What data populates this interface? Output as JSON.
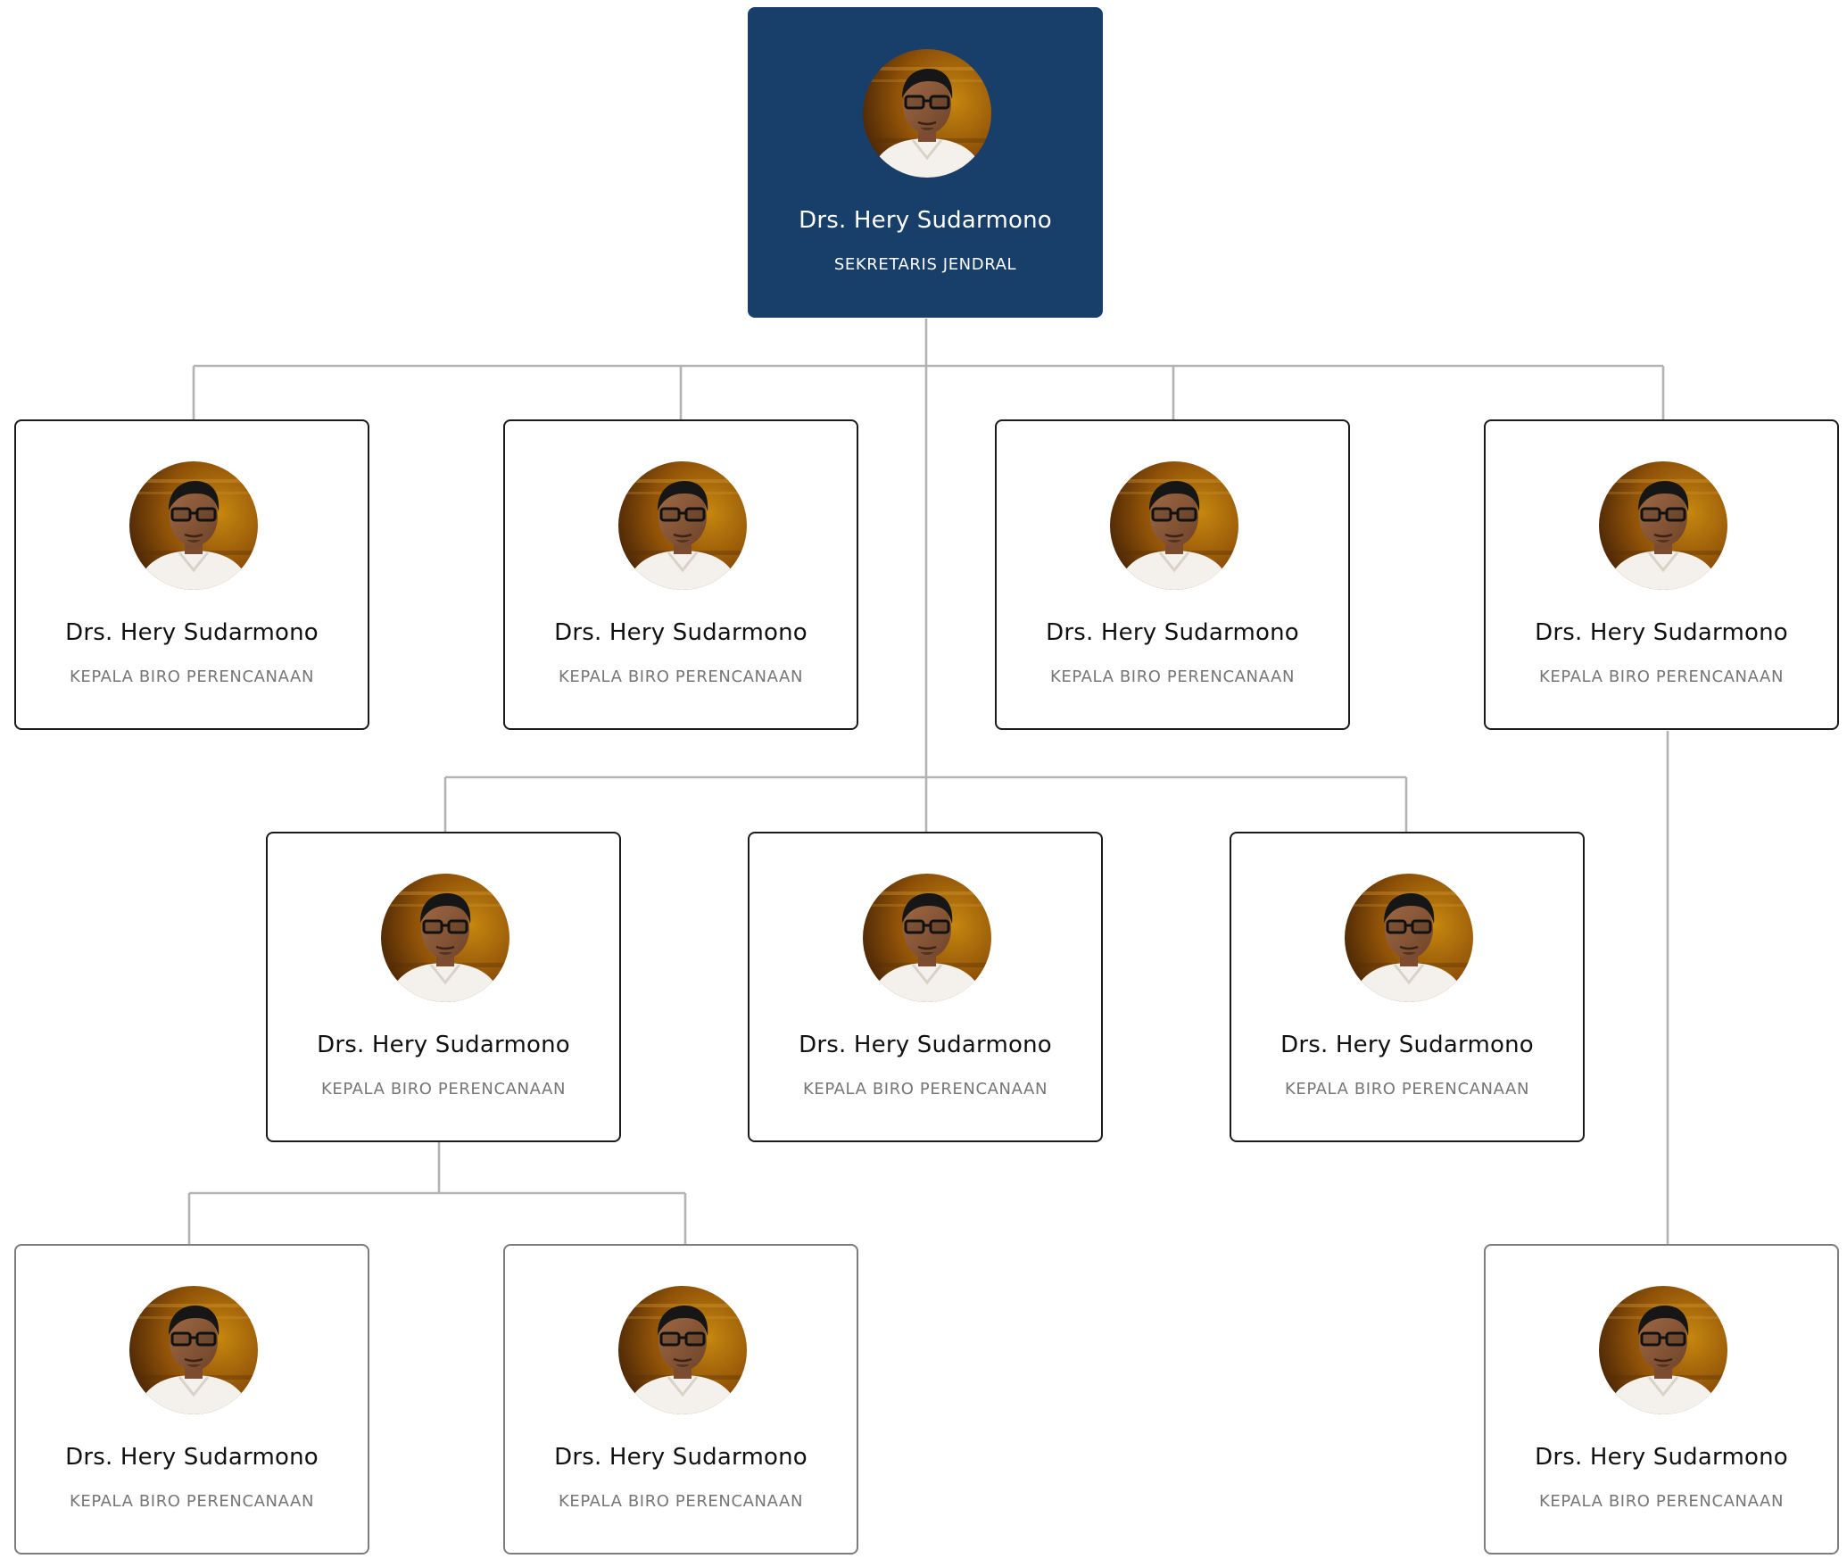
{
  "org_chart": {
    "root": {
      "name": "Drs. Hery Sudarmono",
      "title": "SEKRETARIS JENDRAL",
      "photo": "portrait-photo"
    },
    "level_2": [
      {
        "name": "Drs. Hery Sudarmono",
        "title": "KEPALA BIRO PERENCANAAN",
        "photo": "portrait-photo"
      },
      {
        "name": "Drs. Hery Sudarmono",
        "title": "KEPALA BIRO PERENCANAAN",
        "photo": "portrait-photo"
      },
      {
        "name": "Drs. Hery Sudarmono",
        "title": "KEPALA BIRO PERENCANAAN",
        "photo": "portrait-photo"
      },
      {
        "name": "Drs. Hery Sudarmono",
        "title": "KEPALA BIRO PERENCANAAN",
        "photo": "portrait-photo"
      }
    ],
    "level_3": [
      {
        "name": "Drs. Hery Sudarmono",
        "title": "KEPALA BIRO PERENCANAAN",
        "photo": "portrait-photo"
      },
      {
        "name": "Drs. Hery Sudarmono",
        "title": "KEPALA BIRO PERENCANAAN",
        "photo": "portrait-photo"
      },
      {
        "name": "Drs. Hery Sudarmono",
        "title": "KEPALA BIRO PERENCANAAN",
        "photo": "portrait-photo"
      }
    ],
    "level_4": [
      {
        "name": "Drs. Hery Sudarmono",
        "title": "KEPALA BIRO PERENCANAAN",
        "photo": "portrait-photo"
      },
      {
        "name": "Drs. Hery Sudarmono",
        "title": "KEPALA BIRO PERENCANAAN",
        "photo": "portrait-photo"
      },
      {
        "name": "Drs. Hery Sudarmono",
        "title": "KEPALA BIRO PERENCANAAN",
        "photo": "portrait-photo"
      }
    ]
  },
  "colors": {
    "root_card": "#183f69",
    "connector": "#b3b3b3",
    "card_border": "#1a1a1a",
    "title_text": "#767676"
  }
}
